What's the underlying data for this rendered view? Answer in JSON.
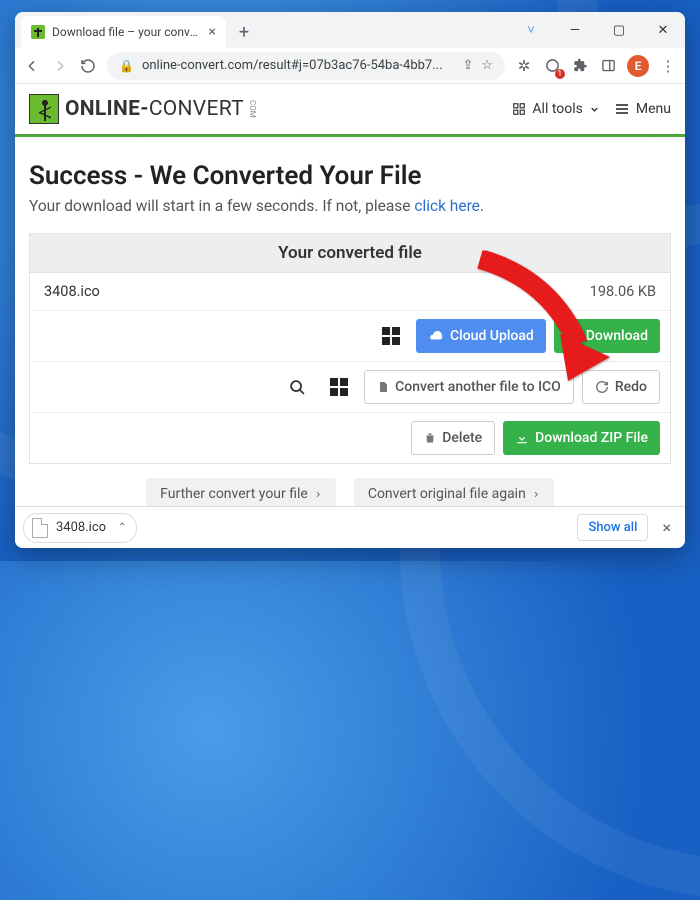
{
  "browser": {
    "tab_title": "Download file – your conversion",
    "url": "online-convert.com/result#j=07b3ac76-54ba-4bb7...",
    "avatar_letter": "E",
    "notification_count": "1"
  },
  "win": {
    "chev": "˅",
    "min": "—",
    "max": "▢",
    "close": "✕"
  },
  "site": {
    "logo_line1": "ONLINE-",
    "logo_line2": "CONVERT",
    "logo_tld": "COM",
    "all_tools": "All tools",
    "menu": "Menu"
  },
  "page": {
    "heading": "Success - We Converted Your File",
    "sub_pre": "Your download will start in a few seconds. If not, please ",
    "sub_link": "click here",
    "sub_post": ".",
    "panel_title": "Your converted file",
    "file_name": "3408.ico",
    "file_size": "198.06 KB",
    "cloud_upload": "Cloud Upload",
    "download": "Download",
    "convert_another": "Convert another file to ICO",
    "redo": "Redo",
    "delete": "Delete",
    "download_zip": "Download ZIP File",
    "further": "Further convert your file",
    "convert_again": "Convert original file again"
  },
  "dlbar": {
    "file": "3408.ico",
    "show_all": "Show all"
  }
}
